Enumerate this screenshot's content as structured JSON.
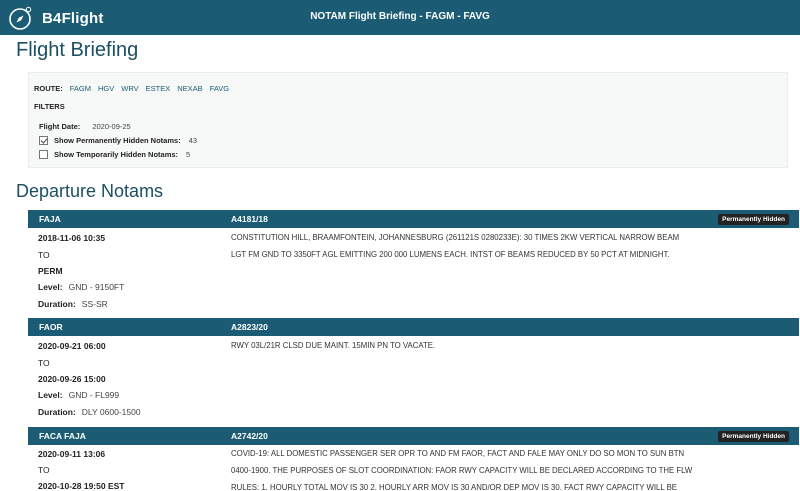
{
  "app": {
    "brand": "B4Flight",
    "title": "NOTAM Flight Briefing - FAGM - FAVG"
  },
  "page_title": "Flight Briefing",
  "filters": {
    "route_label": "ROUTE:",
    "route": [
      "FAGM",
      "HGV",
      "WRV",
      "ESTEX",
      "NEXAB",
      "FAVG"
    ],
    "heading": "FILTERS",
    "flight_date_label": "Flight Date:",
    "flight_date": "2020-09-25",
    "permanently_hidden_label": "Show Permanently Hidden Notams:",
    "permanently_hidden_count": "43",
    "permanently_hidden_checked": true,
    "temporarily_hidden_label": "Show Temporarily Hidden Notams:",
    "temporarily_hidden_count": "5",
    "temporarily_hidden_checked": false
  },
  "section_title": "Departure Notams",
  "notams": [
    {
      "location": "FAJA",
      "id": "A4181/18",
      "badge": "Permanently Hidden",
      "from": "2018-11-06 10:35",
      "to_label": "TO",
      "to": "PERM",
      "level_label": "Level:",
      "level": "GND - 9150FT",
      "duration_label": "Duration:",
      "duration": "SS-SR",
      "text_lines": [
        "CONSTITUTION HILL, BRAAMFONTEIN, JOHANNESBURG (261121S 0280233E): 30 TIMES 2KW VERTICAL NARROW BEAM",
        "LGT FM GND TO 3350FT AGL EMITTING 200 000 LUMENS EACH. INTST OF BEAMS REDUCED BY 50 PCT AT MIDNIGHT."
      ]
    },
    {
      "location": "FAOR",
      "id": "A2823/20",
      "badge": "",
      "from": "2020-09-21 06:00",
      "to_label": "TO",
      "to": "2020-09-26 15:00",
      "level_label": "Level:",
      "level": "GND - FL999",
      "duration_label": "Duration:",
      "duration": "DLY 0600-1500",
      "text_lines": [
        "RWY 03L/21R CLSD DUE MAINT. 15MIN PN TO VACATE."
      ]
    },
    {
      "location": "FACA FAJA",
      "id": "A2742/20",
      "badge": "Permanently Hidden",
      "from": "2020-09-11 13:06",
      "to_label": "TO",
      "to": "2020-10-28 19:50 EST",
      "text_lines": [
        "COVID-19: ALL DOMESTIC PASSENGER SER OPR TO AND FM FAOR, FACT AND FALE MAY ONLY DO SO MON TO SUN BTN",
        "0400-1900. THE PURPOSES OF SLOT COORDINATION: FAOR RWY CAPACITY WILL BE DECLARED ACCORDING TO THE FLW",
        "RULES: 1. HOURLY TOTAL MOV IS 30 2. HOURLY ARR MOV IS 30 AND/OR DEP MOV IS 30. FACT RWY CAPACITY WILL BE"
      ]
    }
  ],
  "colors": {
    "header_bg": "#1b5c74",
    "title_color": "#1b4f63",
    "badge_bg": "#222222"
  }
}
